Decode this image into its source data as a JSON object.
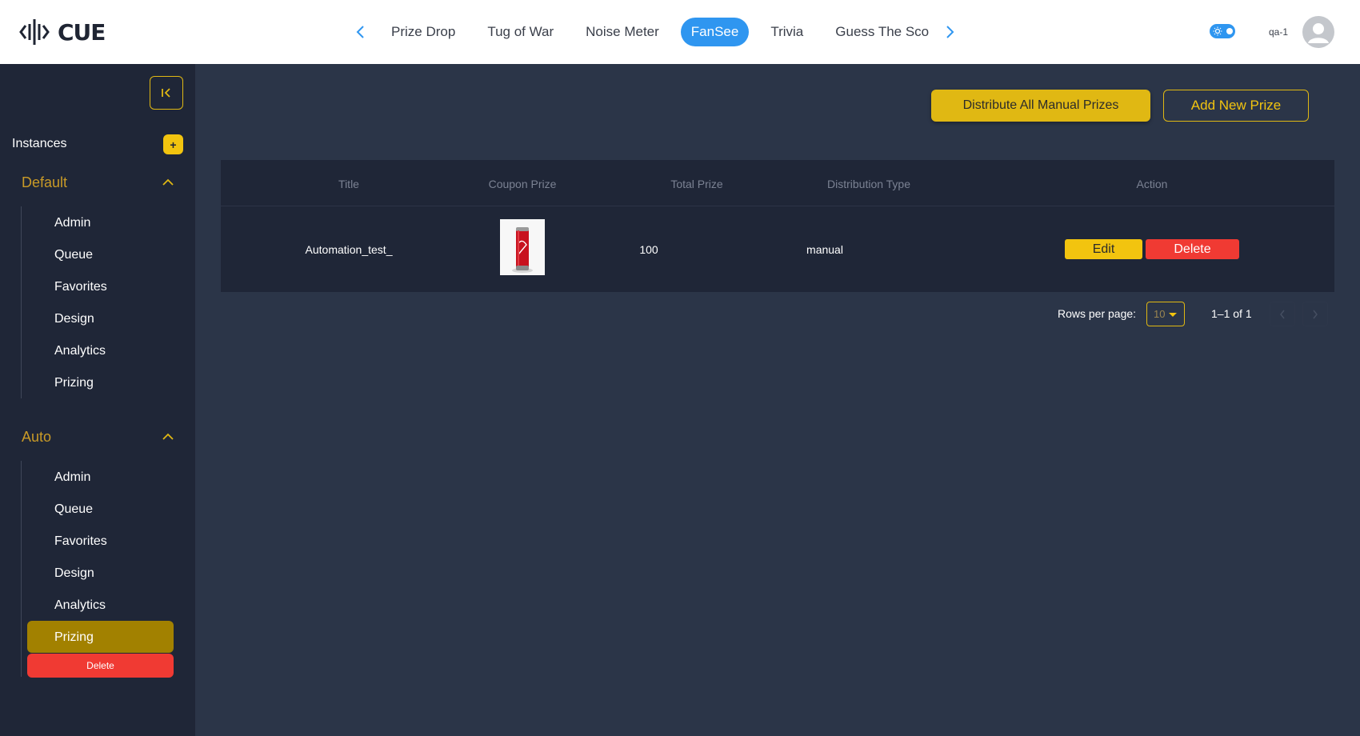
{
  "header": {
    "logo_text": "CUE",
    "nav_tabs": [
      {
        "label": "Prize Drop",
        "active": false
      },
      {
        "label": "Tug of War",
        "active": false
      },
      {
        "label": "Noise Meter",
        "active": false
      },
      {
        "label": "FanSee",
        "active": true
      },
      {
        "label": "Trivia",
        "active": false
      },
      {
        "label": "Guess The Score",
        "active": false
      }
    ],
    "user_name": "qa-1"
  },
  "sidebar": {
    "instances_label": "Instances",
    "add_label": "+",
    "groups": [
      {
        "title": "Default",
        "items": [
          "Admin",
          "Queue",
          "Favorites",
          "Design",
          "Analytics",
          "Prizing"
        ]
      },
      {
        "title": "Auto",
        "items": [
          "Admin",
          "Queue",
          "Favorites",
          "Design",
          "Analytics",
          "Prizing"
        ],
        "active_item": "Prizing",
        "delete_label": "Delete"
      }
    ]
  },
  "main": {
    "distribute_label": "Distribute All Manual Prizes",
    "add_prize_label": "Add New Prize",
    "table": {
      "columns": [
        "Title",
        "Coupon Prize",
        "Total Prize",
        "Distribution Type",
        "Action"
      ],
      "rows": [
        {
          "title": "Automation_test_",
          "coupon_image": "coca-cola can",
          "total_prize": "100",
          "distribution_type": "manual"
        }
      ],
      "edit_label": "Edit",
      "delete_label": "Delete"
    },
    "pagination": {
      "rows_per_page_label": "Rows per page:",
      "rows_per_page_value": "10",
      "range": "1–1 of 1"
    }
  },
  "colors": {
    "accent_yellow": "#f2c40f",
    "active_tab_blue": "#2f96f0",
    "danger_red": "#f03a33",
    "sidebar_active": "#a28100"
  }
}
